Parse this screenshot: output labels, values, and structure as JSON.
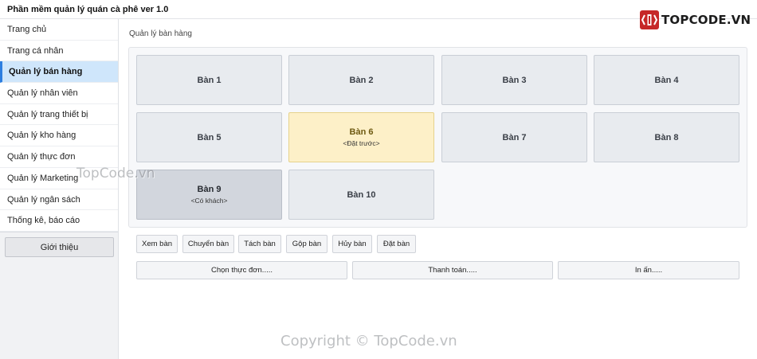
{
  "app": {
    "title": "Phần mềm quản lý quán cà phê ver 1.0"
  },
  "logo": {
    "text": "TOPCODE.VN",
    "color": "#c62828"
  },
  "sidebar": {
    "items": [
      {
        "label": "Trang chủ",
        "active": false
      },
      {
        "label": "Trang cá nhân",
        "active": false
      },
      {
        "label": "Quản lý bán hàng",
        "active": true
      },
      {
        "label": "Quản lý nhân viên",
        "active": false
      },
      {
        "label": "Quản lý trang thiết bị",
        "active": false
      },
      {
        "label": "Quản lý kho hàng",
        "active": false
      },
      {
        "label": "Quản lý thực đơn",
        "active": false
      },
      {
        "label": "Quản lý Marketing",
        "active": false
      },
      {
        "label": "Quản lý ngân sách",
        "active": false
      },
      {
        "label": "Thống kê, báo cáo",
        "active": false
      }
    ],
    "about_label": "Giới thiệu"
  },
  "main": {
    "breadcrumb": "Quản lý bàn hàng",
    "tables": [
      {
        "name": "Bàn 1",
        "status": ""
      },
      {
        "name": "Bàn 2",
        "status": ""
      },
      {
        "name": "Bàn 3",
        "status": ""
      },
      {
        "name": "Bàn 4",
        "status": ""
      },
      {
        "name": "Bàn 5",
        "status": ""
      },
      {
        "name": "Bàn 6",
        "status": "<Đặt trước>",
        "state": "reserved"
      },
      {
        "name": "Bàn 7",
        "status": ""
      },
      {
        "name": "Bàn 8",
        "status": ""
      },
      {
        "name": "Bàn 9",
        "status": "<Có khách>",
        "state": "occupied"
      },
      {
        "name": "Bàn 10",
        "status": ""
      }
    ],
    "actions": [
      "Xem bàn",
      "Chuyển bàn",
      "Tách bàn",
      "Gộp bàn",
      "Hủy bàn",
      "Đặt bàn"
    ],
    "wide_actions": [
      "Chọn thực đơn.....",
      "Thanh toán.....",
      "In ấn....."
    ]
  },
  "colors": {
    "active_menu": "#cfe6fb",
    "accent": "#2d7ee0",
    "reserved": "#fdf0c8",
    "occupied": "#d2d6dd"
  },
  "watermarks": {
    "side": "TopCode.vn",
    "bottom": "Copyright © TopCode.vn"
  }
}
